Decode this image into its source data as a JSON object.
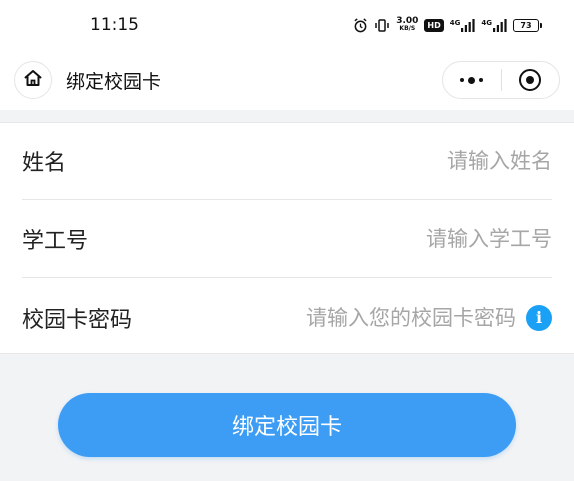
{
  "status_bar": {
    "time": "11:15",
    "net_speed_value": "3.00",
    "net_speed_unit": "KB/S",
    "hd_label": "HD",
    "signal1_label": "4G",
    "signal2_label": "4G",
    "battery_level": "73"
  },
  "nav": {
    "title": "绑定校园卡"
  },
  "form": {
    "name": {
      "label": "姓名",
      "placeholder": "请输入姓名"
    },
    "student_id": {
      "label": "学工号",
      "placeholder": "请输入学工号"
    },
    "card_password": {
      "label": "校园卡密码",
      "placeholder": "请输入您的校园卡密码",
      "info_glyph": "i"
    }
  },
  "submit": {
    "label": "绑定校园卡"
  },
  "colors": {
    "accent": "#3d9df5",
    "info": "#1aa1f5",
    "background": "#f2f3f5"
  }
}
